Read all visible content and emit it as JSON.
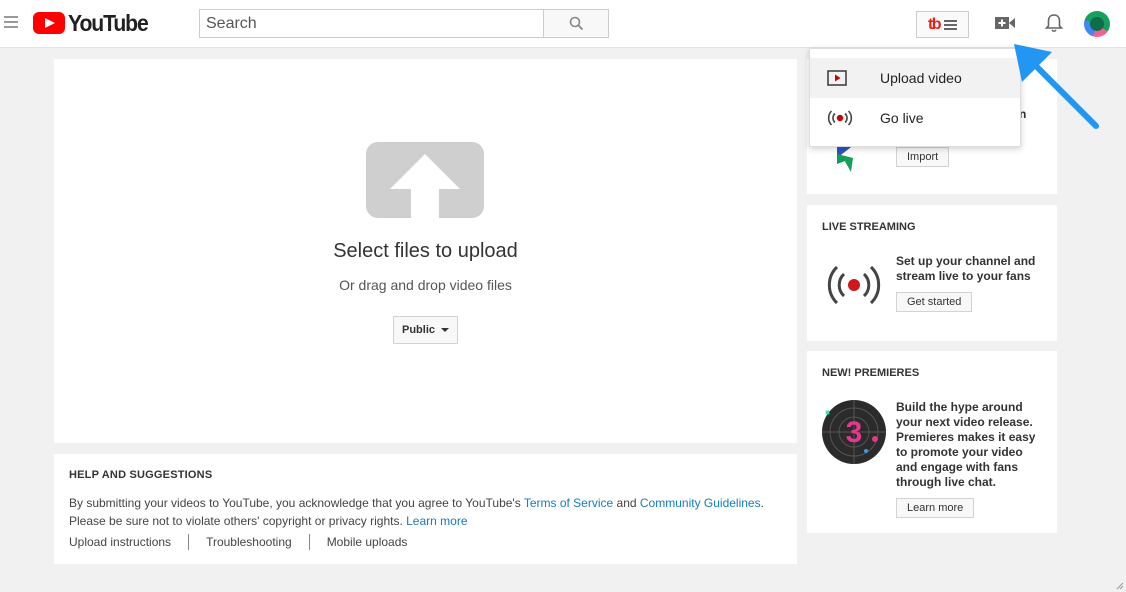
{
  "header": {
    "logo_text": "YouTube",
    "search_placeholder": "Search",
    "tubebuddy_logo": "tb"
  },
  "upload": {
    "title": "Select files to upload",
    "subtitle": "Or drag and drop video files",
    "privacy_selected": "Public"
  },
  "help": {
    "title": "HELP AND SUGGESTIONS",
    "text_1": "By submitting your videos to YouTube, you acknowledge that you agree to YouTube's ",
    "terms_link": "Terms of Service",
    "text_and": " and ",
    "guidelines_link": "Community Guidelines",
    "text_period": ".",
    "text_2": "Please be sure not to violate others' copyright or privacy rights. ",
    "learn_more_link": "Learn more",
    "links": [
      "Upload instructions",
      "Troubleshooting",
      "Mobile uploads"
    ]
  },
  "import_card": {
    "partial_text": "n",
    "button": "Import"
  },
  "live_card": {
    "title": "LIVE STREAMING",
    "text_line1": "Set up your channel and",
    "text_line2": "stream live to your fans",
    "button": "Get started"
  },
  "premieres_card": {
    "title": "NEW! PREMIERES",
    "lines": [
      "Build the hype around",
      "your next video release.",
      "Premieres makes it easy",
      "to promote your video",
      "and engage with fans",
      "through live chat."
    ],
    "button": "Learn more",
    "countdown_digit": "3"
  },
  "create_menu": {
    "items": [
      {
        "label": "Upload video",
        "icon": "upload-video-icon"
      },
      {
        "label": "Go live",
        "icon": "go-live-icon"
      }
    ]
  },
  "colors": {
    "brand_red": "#ff0000",
    "link_blue": "#167ac6",
    "pointer_blue": "#2196f3",
    "live_red": "#cc0000"
  }
}
